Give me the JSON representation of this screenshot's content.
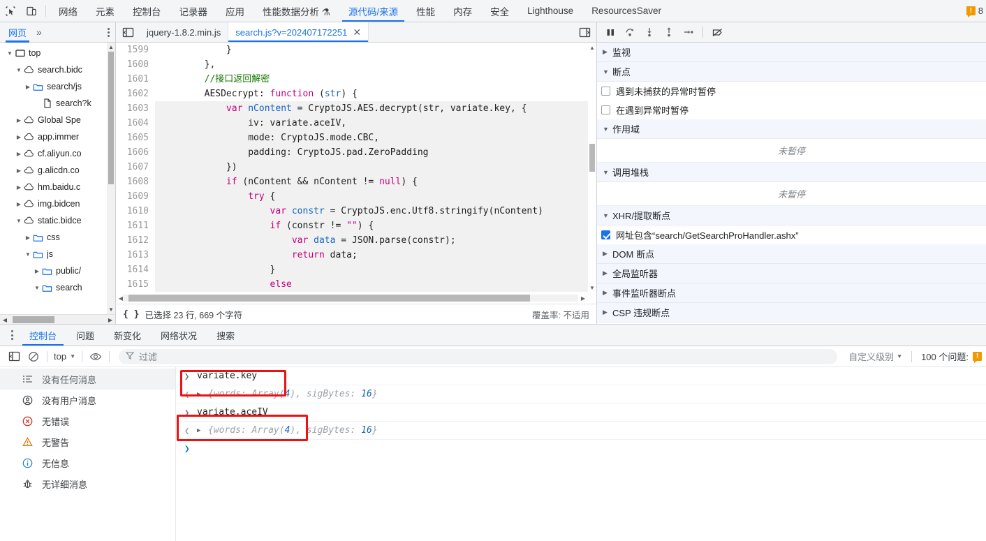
{
  "main_tabs": {
    "icons": [
      "inspect-icon",
      "device-toggle-icon"
    ],
    "items": [
      {
        "label": "网络",
        "selected": false
      },
      {
        "label": "元素",
        "selected": false
      },
      {
        "label": "控制台",
        "selected": false
      },
      {
        "label": "记录器",
        "selected": false
      },
      {
        "label": "应用",
        "selected": false
      },
      {
        "label": "性能数据分析 ⚗",
        "selected": false
      },
      {
        "label": "源代码/来源",
        "selected": true
      },
      {
        "label": "性能",
        "selected": false
      },
      {
        "label": "内存",
        "selected": false
      },
      {
        "label": "安全",
        "selected": false
      },
      {
        "label": "Lighthouse",
        "selected": false
      },
      {
        "label": "ResourcesSaver",
        "selected": false
      }
    ],
    "error_badge": "!",
    "error_count": "8"
  },
  "navigator": {
    "tab_label": "网页",
    "more_label": "»",
    "tree": [
      {
        "label": "top",
        "depth": 0,
        "caret": "▼",
        "icon": "frame-icon"
      },
      {
        "label": "search.bidc",
        "depth": 1,
        "caret": "▼",
        "icon": "cloud-icon"
      },
      {
        "label": "search/js",
        "depth": 2,
        "caret": "▶",
        "icon": "folder-icon"
      },
      {
        "label": "search?k",
        "depth": 3,
        "caret": "",
        "icon": "file-icon"
      },
      {
        "label": "Global Spe",
        "depth": 1,
        "caret": "▶",
        "icon": "cloud-icon"
      },
      {
        "label": "app.immer",
        "depth": 1,
        "caret": "▶",
        "icon": "cloud-icon"
      },
      {
        "label": "cf.aliyun.co",
        "depth": 1,
        "caret": "▶",
        "icon": "cloud-icon"
      },
      {
        "label": "g.alicdn.co",
        "depth": 1,
        "caret": "▶",
        "icon": "cloud-icon"
      },
      {
        "label": "hm.baidu.c",
        "depth": 1,
        "caret": "▶",
        "icon": "cloud-icon"
      },
      {
        "label": "img.bidcen",
        "depth": 1,
        "caret": "▶",
        "icon": "cloud-icon"
      },
      {
        "label": "static.bidce",
        "depth": 1,
        "caret": "▼",
        "icon": "cloud-icon"
      },
      {
        "label": "css",
        "depth": 2,
        "caret": "▶",
        "icon": "folder-icon"
      },
      {
        "label": "js",
        "depth": 2,
        "caret": "▼",
        "icon": "folder-icon"
      },
      {
        "label": "public/",
        "depth": 3,
        "caret": "▶",
        "icon": "folder-icon"
      },
      {
        "label": "search",
        "depth": 3,
        "caret": "▼",
        "icon": "folder-icon"
      }
    ]
  },
  "editor": {
    "tabs": [
      {
        "label": "jquery-1.8.2.min.js",
        "selected": false,
        "closable": false
      },
      {
        "label": "search.js?v=202407172251",
        "selected": true,
        "closable": true,
        "close": "✕"
      }
    ],
    "panel_toggle_icon": "show-navigator-icon",
    "split_icon": "show-debugger-icon",
    "lines": [
      {
        "n": "1599",
        "hl": false,
        "tokens": [
          {
            "t": "            }",
            "c": "plain"
          }
        ]
      },
      {
        "n": "1600",
        "hl": false,
        "tokens": [
          {
            "t": "        },",
            "c": "plain"
          }
        ]
      },
      {
        "n": "1601",
        "hl": false,
        "tokens": [
          {
            "t": "        //接口返回解密",
            "c": "cmt"
          }
        ]
      },
      {
        "n": "1602",
        "hl": false,
        "tokens": [
          {
            "t": "        AESDecrypt: ",
            "c": "plain"
          },
          {
            "t": "function",
            "c": "pink"
          },
          {
            "t": " (",
            "c": "plain"
          },
          {
            "t": "str",
            "c": "blue"
          },
          {
            "t": ") {",
            "c": "plain"
          }
        ]
      },
      {
        "n": "1603",
        "hl": true,
        "tokens": [
          {
            "t": "            ",
            "c": "plain"
          },
          {
            "t": "var",
            "c": "pink"
          },
          {
            "t": " ",
            "c": "plain"
          },
          {
            "t": "nContent",
            "c": "blue"
          },
          {
            "t": " = CryptoJS.AES.decrypt(str, variate.key, {",
            "c": "plain"
          }
        ]
      },
      {
        "n": "1604",
        "hl": true,
        "tokens": [
          {
            "t": "                iv: variate.aceIV,",
            "c": "plain"
          }
        ]
      },
      {
        "n": "1605",
        "hl": true,
        "tokens": [
          {
            "t": "                mode: CryptoJS.mode.CBC,",
            "c": "plain"
          }
        ]
      },
      {
        "n": "1606",
        "hl": true,
        "tokens": [
          {
            "t": "                padding: CryptoJS.pad.ZeroPadding",
            "c": "plain"
          }
        ]
      },
      {
        "n": "1607",
        "hl": true,
        "tokens": [
          {
            "t": "            })",
            "c": "plain"
          }
        ]
      },
      {
        "n": "1608",
        "hl": true,
        "tokens": [
          {
            "t": "            ",
            "c": "plain"
          },
          {
            "t": "if",
            "c": "pink"
          },
          {
            "t": " (nContent && nContent != ",
            "c": "plain"
          },
          {
            "t": "null",
            "c": "pink"
          },
          {
            "t": ") {",
            "c": "plain"
          }
        ]
      },
      {
        "n": "1609",
        "hl": true,
        "tokens": [
          {
            "t": "                ",
            "c": "plain"
          },
          {
            "t": "try",
            "c": "pink"
          },
          {
            "t": " {",
            "c": "plain"
          }
        ]
      },
      {
        "n": "1610",
        "hl": true,
        "tokens": [
          {
            "t": "                    ",
            "c": "plain"
          },
          {
            "t": "var",
            "c": "pink"
          },
          {
            "t": " ",
            "c": "plain"
          },
          {
            "t": "constr",
            "c": "blue"
          },
          {
            "t": " = CryptoJS.enc.Utf8.stringify(nContent)",
            "c": "plain"
          }
        ]
      },
      {
        "n": "1611",
        "hl": true,
        "tokens": [
          {
            "t": "                    ",
            "c": "plain"
          },
          {
            "t": "if",
            "c": "pink"
          },
          {
            "t": " (constr != ",
            "c": "plain"
          },
          {
            "t": "\"\"",
            "c": "pink"
          },
          {
            "t": ") {",
            "c": "plain"
          }
        ]
      },
      {
        "n": "1612",
        "hl": true,
        "tokens": [
          {
            "t": "                        ",
            "c": "plain"
          },
          {
            "t": "var",
            "c": "pink"
          },
          {
            "t": " ",
            "c": "plain"
          },
          {
            "t": "data",
            "c": "blue"
          },
          {
            "t": " = JSON.parse(constr);",
            "c": "plain"
          }
        ]
      },
      {
        "n": "1613",
        "hl": true,
        "tokens": [
          {
            "t": "                        ",
            "c": "plain"
          },
          {
            "t": "return",
            "c": "pink"
          },
          {
            "t": " data;",
            "c": "plain"
          }
        ]
      },
      {
        "n": "1614",
        "hl": true,
        "tokens": [
          {
            "t": "                    }",
            "c": "plain"
          }
        ]
      },
      {
        "n": "1615",
        "hl": true,
        "tokens": [
          {
            "t": "                    ",
            "c": "plain"
          },
          {
            "t": "else",
            "c": "pink"
          }
        ]
      }
    ],
    "status": {
      "braces": "{ }",
      "selection": "已选择 23 行, 669 个字符",
      "coverage": "覆盖率: 不适用"
    }
  },
  "debugger": {
    "toolbar_icons": [
      "pause-resume-icon",
      "step-over-icon",
      "step-into-icon",
      "step-out-icon",
      "step-icon",
      "deactivate-breakpoints-icon"
    ],
    "sections": [
      {
        "name": "watch",
        "caret": "▶",
        "label": "监视",
        "rows": []
      },
      {
        "name": "breakpoints",
        "caret": "▼",
        "label": "断点",
        "rows": [
          {
            "type": "checkbox",
            "checked": false,
            "label": "遇到未捕获的异常时暂停"
          },
          {
            "type": "checkbox",
            "checked": false,
            "label": "在遇到异常时暂停"
          }
        ]
      },
      {
        "name": "scope",
        "caret": "▼",
        "label": "作用域",
        "empty": "未暂停"
      },
      {
        "name": "call-stack",
        "caret": "▼",
        "label": "调用堆栈",
        "empty": "未暂停"
      },
      {
        "name": "xhr-breakpoints",
        "caret": "▼",
        "label": "XHR/提取断点",
        "rows": [
          {
            "type": "checkbox",
            "checked": true,
            "label": "网址包含“search/GetSearchProHandler.ashx”"
          }
        ]
      },
      {
        "name": "dom-breakpoints",
        "caret": "▶",
        "label": "DOM 断点",
        "rows": []
      },
      {
        "name": "global-listeners",
        "caret": "▶",
        "label": "全局监听器",
        "rows": []
      },
      {
        "name": "event-listener-breakpoints",
        "caret": "▶",
        "label": "事件监听器断点",
        "rows": []
      },
      {
        "name": "csp-violation-breakpoints",
        "caret": "▶",
        "label": "CSP 违规断点",
        "rows": []
      }
    ]
  },
  "drawer": {
    "tabs": [
      {
        "label": "控制台",
        "selected": true
      },
      {
        "label": "问题",
        "selected": false
      },
      {
        "label": "新变化",
        "selected": false
      },
      {
        "label": "网络状况",
        "selected": false
      },
      {
        "label": "搜索",
        "selected": false
      }
    ]
  },
  "console": {
    "toolbar": {
      "sidebar_icon": "show-console-sidebar-icon",
      "clear_icon": "clear-console-icon",
      "context": "top",
      "context_caret": "▼",
      "eye_icon": "live-expression-icon",
      "filter_icon": "filter-icon",
      "filter_placeholder": "过滤",
      "level": "自定义级别",
      "level_caret": "▼",
      "issues_label": "100 个问题:",
      "issues_badge": "!"
    },
    "sidebar": [
      {
        "icon": "list-icon",
        "label": "没有任何消息",
        "selected": true
      },
      {
        "icon": "user-icon",
        "label": "没有用户消息",
        "selected": false
      },
      {
        "icon": "error-icon",
        "label": "无错误",
        "selected": false
      },
      {
        "icon": "warning-icon",
        "label": "无警告",
        "selected": false
      },
      {
        "icon": "info-icon",
        "label": "无信息",
        "selected": false
      },
      {
        "icon": "verbose-bug-icon",
        "label": "无详细消息",
        "selected": false
      }
    ],
    "entries": [
      {
        "kind": "input",
        "arrow": "❯",
        "text": "variate.key",
        "highlighted": true
      },
      {
        "kind": "output",
        "arrow": "❮",
        "tri": "▶",
        "prefix": "{words: Array(",
        "num": "4",
        "mid": "), sigBytes: ",
        "num2": "16",
        "suffix": "}"
      },
      {
        "kind": "input",
        "arrow": "❯",
        "text": "variate.aceIV",
        "highlighted": true
      },
      {
        "kind": "output",
        "arrow": "❮",
        "tri": "▶",
        "prefix": "{words: Array(",
        "num": "4",
        "mid": "), sigBytes: ",
        "num2": "16",
        "suffix": "}"
      }
    ],
    "prompt": "❯"
  },
  "colors": {
    "accent": "#1a73e8",
    "highlight_box": "#ee1111",
    "warning": "#f29900",
    "error": "#d93025",
    "comment_green": "#177500",
    "keyword_pink": "#c5007c",
    "variable_blue": "#1565c0"
  }
}
